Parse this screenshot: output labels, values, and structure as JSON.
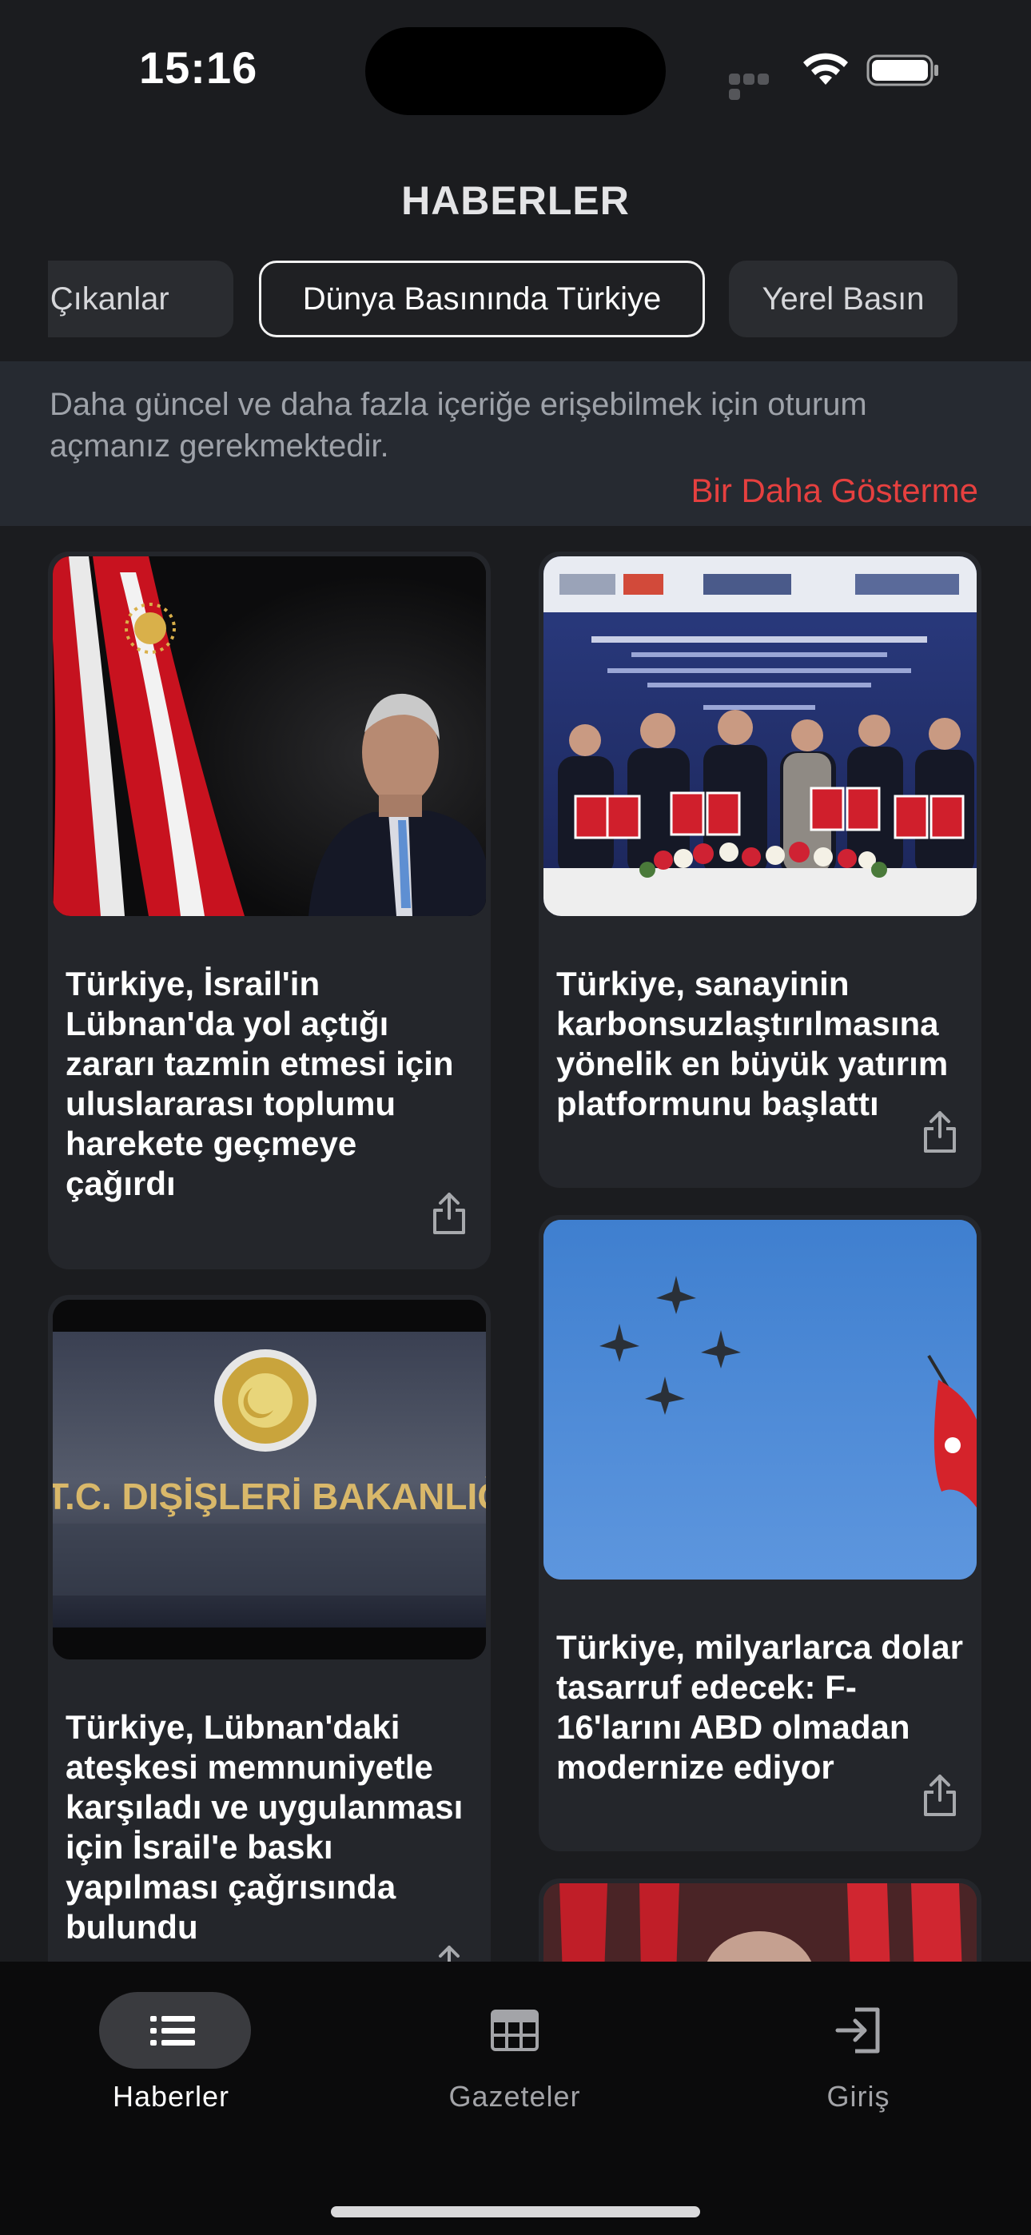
{
  "status": {
    "time": "15:16"
  },
  "header": {
    "title": "HABERLER"
  },
  "tabs": [
    {
      "label": "Öne Çıkanlar"
    },
    {
      "label": "Dünya Basınında Türkiye",
      "selected": true
    },
    {
      "label": "Yerel Basın"
    }
  ],
  "banner": {
    "message": "Daha güncel ve daha fazla içeriğe erişebilmek için oturum açmanız gerekmektedir.",
    "dismiss_label": "Bir Daha Gösterme"
  },
  "articles": [
    {
      "title": "Türkiye, İsrail'in Lübnan'da yol açtığı zararı tazmin etmesi için uluslararası toplumu harekete geçmeye çağırdı",
      "image": "president-with-flags"
    },
    {
      "title": "Türkiye, sanayinin karbonsuzlaştırılmasına yönelik en büyük yatırım platformunu başlattı",
      "image": "signing-ceremony"
    },
    {
      "title": "Türkiye, Lübnan'daki ateşkesi memnuniyetle karşıladı ve uygulanması için İsrail'e baskı yapılması çağrısında bulundu",
      "image": "foreign-ministry-sign"
    },
    {
      "title": "Türkiye, milyarlarca dolar tasarruf edecek: F-16'larını ABD olmadan modernize ediyor",
      "image": "jets-in-formation"
    }
  ],
  "image_text": {
    "ministry_sign": "T.C. DIŞİŞLERİ BAKANLIĞI"
  },
  "tabbar": [
    {
      "label": "Haberler",
      "icon": "list-icon",
      "active": true
    },
    {
      "label": "Gazeteler",
      "icon": "newspaper-icon"
    },
    {
      "label": "Giriş",
      "icon": "login-icon"
    }
  ],
  "colors": {
    "background": "#1b1c1f",
    "card": "#24262b",
    "accent_red": "#e6403f",
    "tab_active": "#ffffff"
  }
}
